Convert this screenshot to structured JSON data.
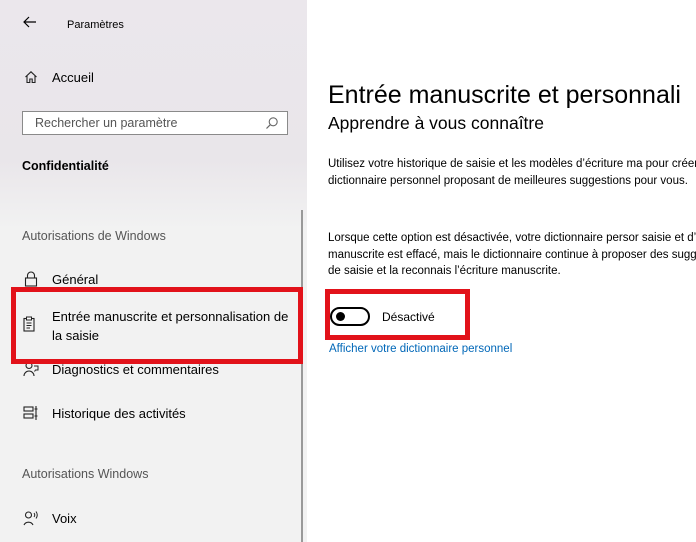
{
  "window": {
    "title": "Paramètres"
  },
  "sidebar": {
    "home_label": "Accueil",
    "search_placeholder": "Rechercher un paramètre",
    "section_title": "Confidentialité",
    "group1_header": "Autorisations de Windows",
    "items": [
      {
        "label": "Général",
        "icon": "lock-icon"
      },
      {
        "label": "Entrée manuscrite et personnalisation de la saisie",
        "icon": "clipboard-icon",
        "active": true
      },
      {
        "label": "Diagnostics et commentaires",
        "icon": "person-feedback-icon"
      },
      {
        "label": "Historique des activités",
        "icon": "timeline-icon"
      }
    ],
    "group2_header": "Autorisations Windows",
    "items2": [
      {
        "label": "Voix",
        "icon": "voice-icon"
      }
    ]
  },
  "main": {
    "title": "Entrée manuscrite et personnali",
    "subtitle": "Apprendre à vous connaître",
    "para1": "Utilisez votre historique de saisie et les modèles d’écriture ma pour créer un dictionnaire personnel proposant de meilleures suggestions pour vous.",
    "para2": "Lorsque cette option est désactivée, votre dictionnaire persor saisie et d’écriture manuscrite est effacé, mais le dictionnaire continue à proposer des suggestions de saisie et la reconnais l’écriture manuscrite.",
    "toggle_label": "Désactivé",
    "toggle_on": false,
    "link": "Afficher votre dictionnaire personnel"
  },
  "colors": {
    "accent": "#0063b1",
    "link": "#0067b8",
    "highlight": "#e2121a"
  }
}
